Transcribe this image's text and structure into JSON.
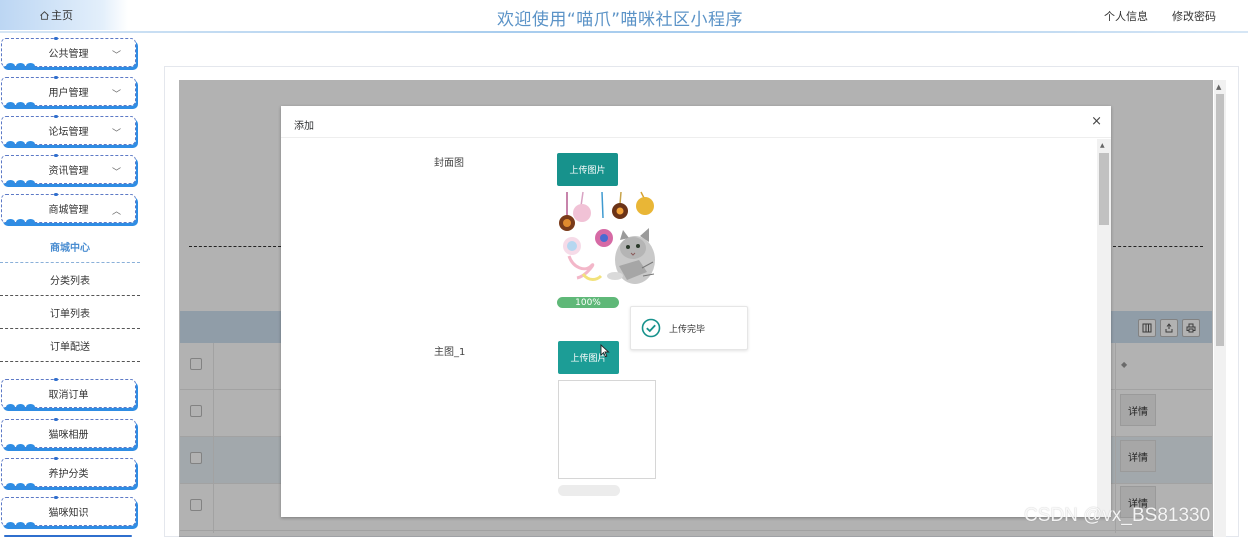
{
  "header": {
    "home_label": "主页",
    "app_title": "欢迎使用“喵爪”喵咪社区小程序",
    "profile_link": "个人信息",
    "password_link": "修改密码"
  },
  "sidebar": {
    "groups": [
      {
        "label": "公共管理",
        "expanded": false
      },
      {
        "label": "用户管理",
        "expanded": false
      },
      {
        "label": "论坛管理",
        "expanded": false
      },
      {
        "label": "资讯管理",
        "expanded": false
      },
      {
        "label": "商城管理",
        "expanded": true
      }
    ],
    "sub_items": [
      {
        "label": "商城中心",
        "active": true
      },
      {
        "label": "分类列表",
        "active": false
      },
      {
        "label": "订单列表",
        "active": false
      },
      {
        "label": "订单配送",
        "active": false
      }
    ],
    "more_items": [
      {
        "label": "取消订单"
      },
      {
        "label": "猫咪相册"
      },
      {
        "label": "养护分类"
      },
      {
        "label": "猫咪知识"
      }
    ]
  },
  "table": {
    "detail_labels": [
      "详情",
      "详情",
      "详情"
    ]
  },
  "dialog": {
    "title": "添加",
    "close_symbol": "×",
    "fields": [
      {
        "label": "封面图",
        "button_label": "上传图片",
        "progress_text": "100%"
      },
      {
        "label": "主图_1",
        "button_label": "上传图片"
      }
    ]
  },
  "toast": {
    "message": "上传完毕"
  },
  "watermark": "CSDN @vx_BS81330",
  "colors": {
    "accent": "#17928c",
    "title_blue": "#5b93c7",
    "sidebar_shadow": "#2f8de4",
    "progress_green": "#5fb878"
  }
}
